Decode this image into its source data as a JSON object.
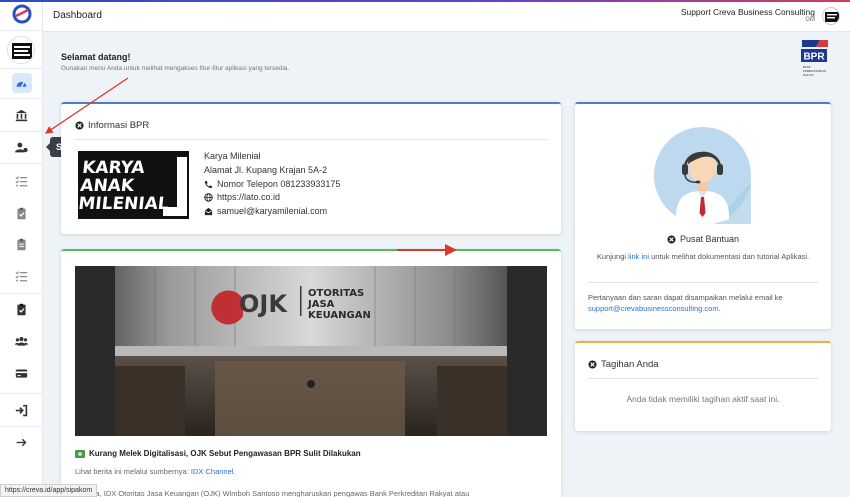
{
  "header": {
    "title": "Dashboard",
    "user_name": "Support Creva Business Consulting",
    "user_role": "GM"
  },
  "sidebar": {
    "tooltip": "SIPAKOM",
    "items": [
      {
        "icon": "gauge-icon",
        "active": true
      },
      {
        "icon": "bank-icon"
      },
      {
        "icon": "user-gear-icon"
      },
      {
        "icon": "list-check-icon"
      },
      {
        "icon": "clipboard-check-icon"
      },
      {
        "icon": "clipboard-list-icon"
      },
      {
        "icon": "list-check-icon"
      },
      {
        "icon": "clipboard-check-icon"
      },
      {
        "icon": "users-icon"
      },
      {
        "icon": "credit-card-icon"
      },
      {
        "icon": "sign-in-icon"
      },
      {
        "icon": "arrow-right-icon"
      }
    ]
  },
  "welcome": {
    "title": "Selamat datang!",
    "subtitle": "Gunakan menu Anda untuk melihat mengakses fitur-fitur aplikasi yang tersedia."
  },
  "bpr_logo": {
    "text": "BPR",
    "caption": "BANK PEREKONOMIAN RAKYAT"
  },
  "info": {
    "title": "Informasi BPR",
    "logo_lines": [
      "KARYA",
      "ANAK",
      "MILENIAL"
    ],
    "name": "Karya Milenial",
    "address": "Alamat Jl. Kupang Krajan 5A-2",
    "phone": "Nomor Telepon 081233933175",
    "website": "https://lato.co.id",
    "email": "samuel@karyamilenial.com"
  },
  "news": {
    "image_sign": [
      "OTORITAS",
      "JASA",
      "KEUANGAN"
    ],
    "image_logo": "OJK",
    "title": "Kurang Melek Digitalisasi, OJK Sebut Pengawasan BPR Sulit Dilakukan",
    "source_prefix": "Lihat berita ini melalui sumbernya:",
    "source_link": "IDX Channel",
    "source_suffix": ".",
    "snippet": "Jakarta, IDX Otoritas Jasa Keuangan (OJK) Wimboh Santoso mengharuskan pengawas Bank Perkreditan Rakyat atau"
  },
  "help": {
    "title": "Pusat Bantuan",
    "desc_prefix": "Kunjungi",
    "desc_link": "link ini",
    "desc_suffix": "untuk melihat dokumentasi dan tutorial Aplikasi.",
    "contact_text": "Pertanyaan dan saran dapat disampaikan melalui email ke",
    "contact_email": "support@crevabusinessconsulting.com",
    "contact_suffix": "."
  },
  "bill": {
    "title": "Tagihan Anda",
    "empty": "Anda tidak memiliki tagihan aktif saat ini."
  },
  "status_url": "https://creva.id/app/sipakom",
  "colors": {
    "accent": "#2f6fd6",
    "annotation": "#d93a2b"
  }
}
